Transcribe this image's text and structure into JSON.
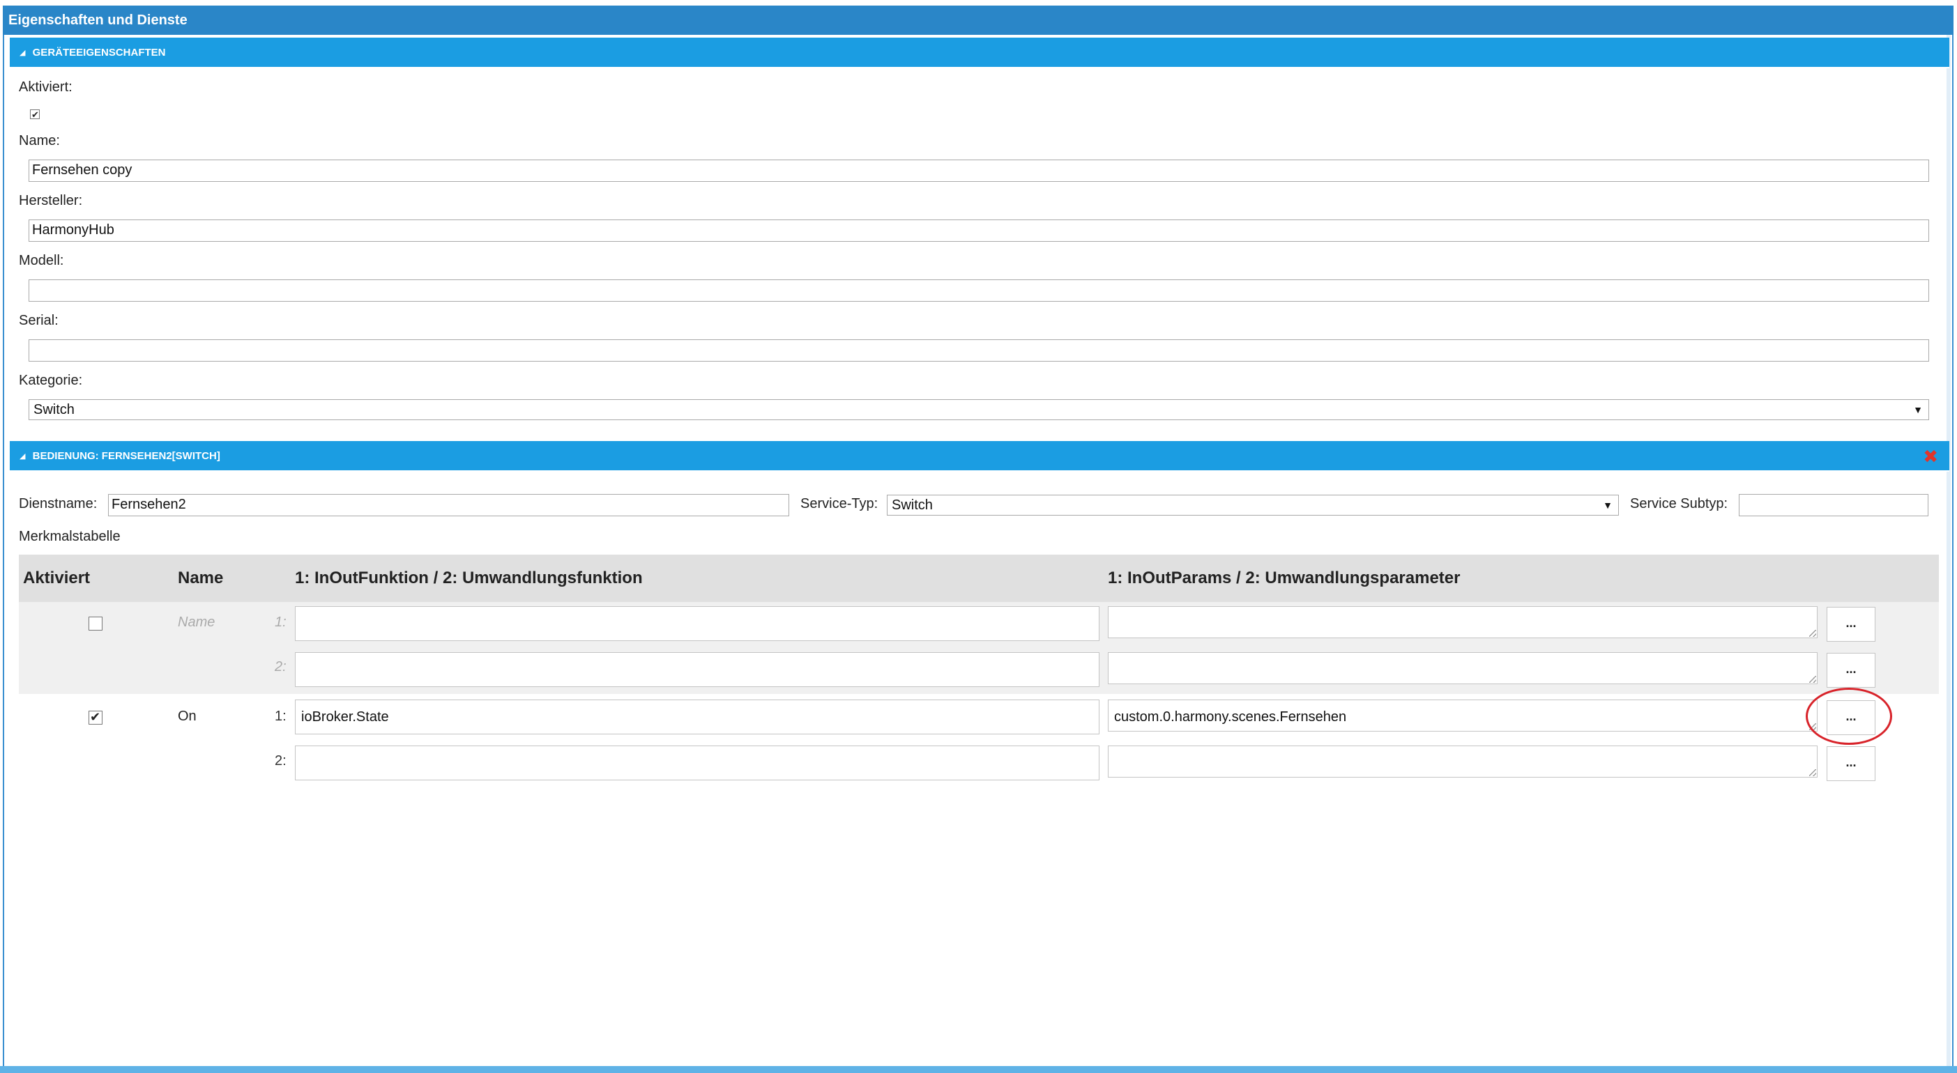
{
  "window": {
    "title": "Eigenschaften und Dienste"
  },
  "device_section": {
    "header": "GERÄTEEIGENSCHAFTEN",
    "fields": {
      "aktiviert_label": "Aktiviert:",
      "aktiviert_checked": true,
      "name_label": "Name:",
      "name_value": "Fernsehen copy",
      "hersteller_label": "Hersteller:",
      "hersteller_value": "HarmonyHub",
      "modell_label": "Modell:",
      "modell_value": "",
      "serial_label": "Serial:",
      "serial_value": "",
      "kategorie_label": "Kategorie:",
      "kategorie_value": "Switch"
    }
  },
  "service_section": {
    "header": "BEDIENUNG: FERNSEHEN2[SWITCH]",
    "dienstname_label": "Dienstname:",
    "dienstname_value": "Fernsehen2",
    "service_typ_label": "Service-Typ:",
    "service_typ_value": "Switch",
    "service_subtyp_label": "Service Subtyp:",
    "service_subtyp_value": "",
    "merkmal_label": "Merkmalstabelle",
    "table": {
      "headers": {
        "aktiviert": "Aktiviert",
        "name": "Name",
        "function": "1: InOutFunktion / 2: Umwandlungsfunktion",
        "params": "1: InOutParams / 2: Umwandlungsparameter"
      },
      "rows": [
        {
          "checked": false,
          "name": "Name",
          "name_is_placeholder": true,
          "line1_label": "1:",
          "line2_label": "2:",
          "func1": "",
          "func2": "",
          "param1": "",
          "param2": "",
          "button": "..."
        },
        {
          "checked": true,
          "name": "On",
          "name_is_placeholder": false,
          "line1_label": "1:",
          "line2_label": "2:",
          "func1": "ioBroker.State",
          "func2": "",
          "param1": "custom.0.harmony.scenes.Fernsehen",
          "param2": "",
          "button": "..."
        }
      ]
    }
  },
  "colors": {
    "title_bar": "#2a86c8",
    "section_header": "#1b9de2",
    "highlight_ring": "#d8232a",
    "close_icon": "#e0352b"
  }
}
